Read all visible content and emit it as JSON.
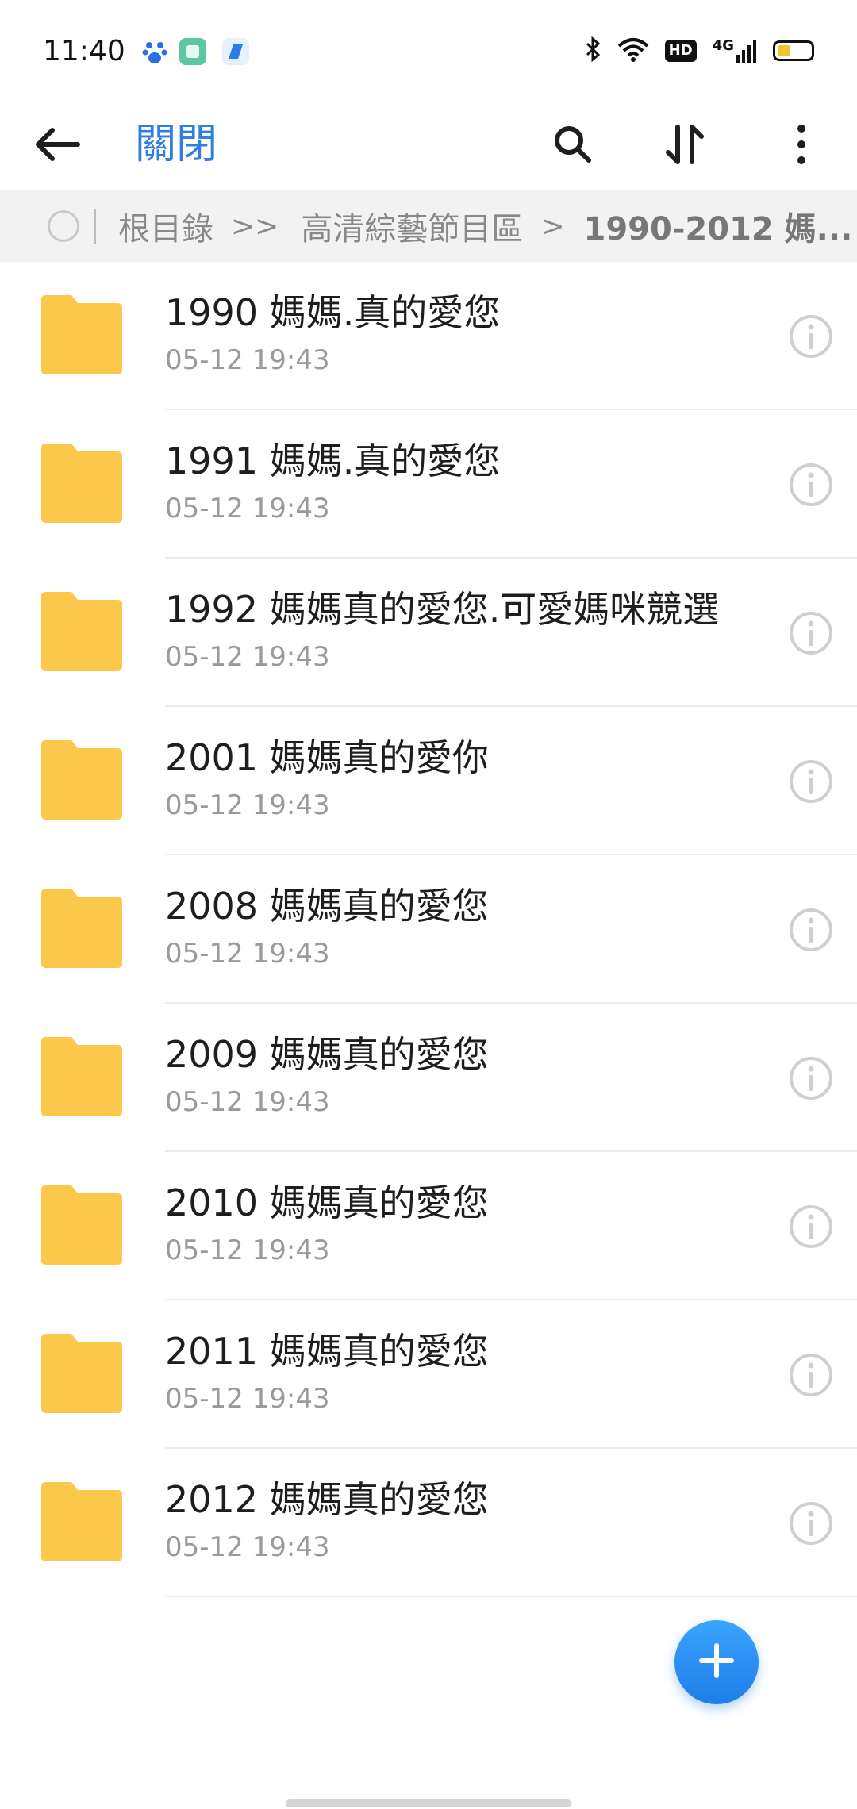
{
  "status_bar": {
    "time": "11:40",
    "network": "4G",
    "hd_label": "HD"
  },
  "app_bar": {
    "title": "關閉"
  },
  "breadcrumb": {
    "root": "根目錄",
    "sep1": ">>",
    "folder": "高清綜藝節目區",
    "sep2": ">",
    "current": "1990-2012 媽..."
  },
  "files": [
    {
      "name": "1990 媽媽.真的愛您",
      "date": "05-12 19:43"
    },
    {
      "name": "1991 媽媽.真的愛您",
      "date": "05-12 19:43"
    },
    {
      "name": "1992 媽媽真的愛您.可愛媽咪競選",
      "date": "05-12 19:43"
    },
    {
      "name": "2001 媽媽真的愛你",
      "date": "05-12 19:43"
    },
    {
      "name": "2008 媽媽真的愛您",
      "date": "05-12 19:43"
    },
    {
      "name": "2009 媽媽真的愛您",
      "date": "05-12 19:43"
    },
    {
      "name": "2010 媽媽真的愛您",
      "date": "05-12 19:43"
    },
    {
      "name": "2011 媽媽真的愛您",
      "date": "05-12 19:43"
    },
    {
      "name": "2012 媽媽真的愛您",
      "date": "05-12 19:43"
    }
  ],
  "colors": {
    "accent": "#2f7fe0",
    "folder": "#fbc84b",
    "fab": "#2a8cf2"
  },
  "icons": {
    "back": "arrow-left-icon",
    "search": "search-icon",
    "sort": "sort-icon",
    "more": "more-vertical-icon",
    "info": "info-icon",
    "folder": "folder-icon",
    "add": "plus-icon"
  }
}
